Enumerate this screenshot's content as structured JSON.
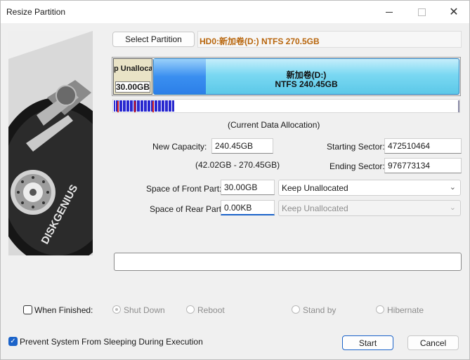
{
  "window": {
    "title": "Resize Partition",
    "close_glyph": "✕"
  },
  "toolbar": {
    "select_partition": "Select Partition",
    "partition_path": "HD0:新加卷(D:) NTFS 270.5GB"
  },
  "disk_map": {
    "unallocated": {
      "label": "p Unalloca",
      "size": "30.00GB"
    },
    "partition": {
      "name": "新加卷(D:)",
      "info": "NTFS 240.45GB",
      "used_fraction": 0.17
    },
    "caption": "(Current Data Allocation)"
  },
  "form": {
    "new_capacity": {
      "label": "New Capacity:",
      "value": "240.45GB",
      "range": "(42.02GB - 270.45GB)"
    },
    "starting_sector": {
      "label": "Starting Sector:",
      "value": "472510464"
    },
    "ending_sector": {
      "label": "Ending Sector:",
      "value": "976773134"
    },
    "front_space": {
      "label": "Space of Front Part:",
      "value": "30.00GB",
      "option": "Keep Unallocated"
    },
    "rear_space": {
      "label": "Space of Rear Part:",
      "value": "0.00KB",
      "option": "Keep Unallocated"
    }
  },
  "when_finished": {
    "label": "When Finished:",
    "checked": false,
    "options": [
      "Shut Down",
      "Reboot",
      "Stand by",
      "Hibernate"
    ],
    "selected": "Shut Down"
  },
  "prevent_sleep": {
    "label": "Prevent System From Sleeping During Execution",
    "checked": true
  },
  "buttons": {
    "start": "Start",
    "cancel": "Cancel"
  },
  "branding": {
    "logo_text": "DISKGENIUS"
  }
}
